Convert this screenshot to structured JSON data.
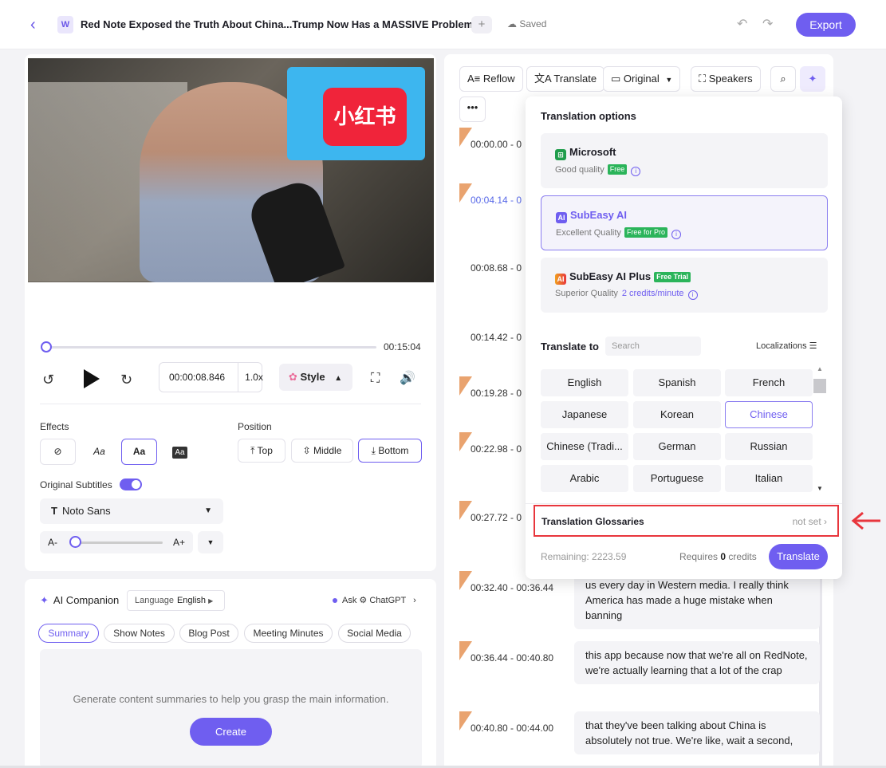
{
  "header": {
    "title": "Red Note Exposed the Truth About China...Trump Now Has a MASSIVE Problem!",
    "saved_label": "Saved",
    "export_label": "Export"
  },
  "video": {
    "overlay_text": "小红书"
  },
  "player": {
    "duration": "00:15:04",
    "current_time": "00:00:08.846",
    "speed": "1.0x",
    "style_label": "Style",
    "progress": 0.005
  },
  "effects": {
    "label": "Effects",
    "options": [
      "⊘",
      "Aa",
      "Aa",
      "Aa"
    ]
  },
  "position": {
    "label": "Position",
    "top_label": "Top",
    "middle_label": "Middle",
    "bottom_label": "Bottom"
  },
  "subtitles": {
    "original_label": "Original Subtitles",
    "font": "Noto Sans",
    "size_minus": "A-",
    "size_plus": "A+"
  },
  "ai": {
    "title": "AI Companion",
    "language_label": "Language",
    "language_value": "English",
    "ask_label": "Ask",
    "ask_model": "ChatGPT",
    "tabs": [
      "Summary",
      "Show Notes",
      "Blog Post",
      "Meeting Minutes",
      "Social Media"
    ],
    "summary_text": "Generate content summaries to help you grasp the main information.",
    "create_label": "Create"
  },
  "editor_toolbar": {
    "reflow": "Reflow",
    "translate": "Translate",
    "original": "Original",
    "speakers": "Speakers",
    "more": "•••"
  },
  "subtitle_rows": [
    {
      "time": "00:00.00 - 0",
      "text": ""
    },
    {
      "time": "00:04.14 - 0",
      "text": ""
    },
    {
      "time": "00:08.68 - 0",
      "text": ""
    },
    {
      "time": "00:14.42 - 0",
      "text": ""
    },
    {
      "time": "00:19.28 - 0",
      "text": ""
    },
    {
      "time": "00:22.98 - 0",
      "text": ""
    },
    {
      "time": "00:27.72 - 0",
      "text": ""
    },
    {
      "time": "00:32.40 - 00:36.44",
      "text": "us every day in Western media. I really think America has made a huge mistake when banning"
    },
    {
      "time": "00:36.44 - 00:40.80",
      "text": "this app because now that we're all on RedNote, we're actually learning that a lot of the crap"
    },
    {
      "time": "00:40.80 - 00:44.00",
      "text": "that they've been talking about China is absolutely not true. We're like, wait a second,"
    }
  ],
  "translation": {
    "title": "Translation options",
    "engines": [
      {
        "name": "Microsoft",
        "desc": "Good quality",
        "badge": "Free",
        "credits": ""
      },
      {
        "name": "SubEasy AI",
        "desc": "Excellent Quality",
        "badge": "Free for Pro",
        "credits": ""
      },
      {
        "name": "SubEasy AI Plus",
        "desc": "Superior Quality",
        "badge": "Free Trial",
        "credits": "2 credits/minute"
      }
    ],
    "translate_to_label": "Translate to",
    "search_placeholder": "Search",
    "localizations_label": "Localizations",
    "languages": [
      "English",
      "Spanish",
      "French",
      "Japanese",
      "Korean",
      "Chinese",
      "Chinese (Tradi...",
      "German",
      "Russian",
      "Arabic",
      "Portuguese",
      "Italian"
    ],
    "selected_language": "Chinese",
    "glossaries_label": "Translation Glossaries",
    "glossaries_value": "not set",
    "remaining": "Remaining: 2223.59",
    "requires_prefix": "Requires",
    "requires_credits": "0",
    "requires_suffix": "credits",
    "translate_button": "Translate"
  },
  "colors": {
    "accent": "#6f5ef0",
    "highlight": "#e8363d"
  }
}
